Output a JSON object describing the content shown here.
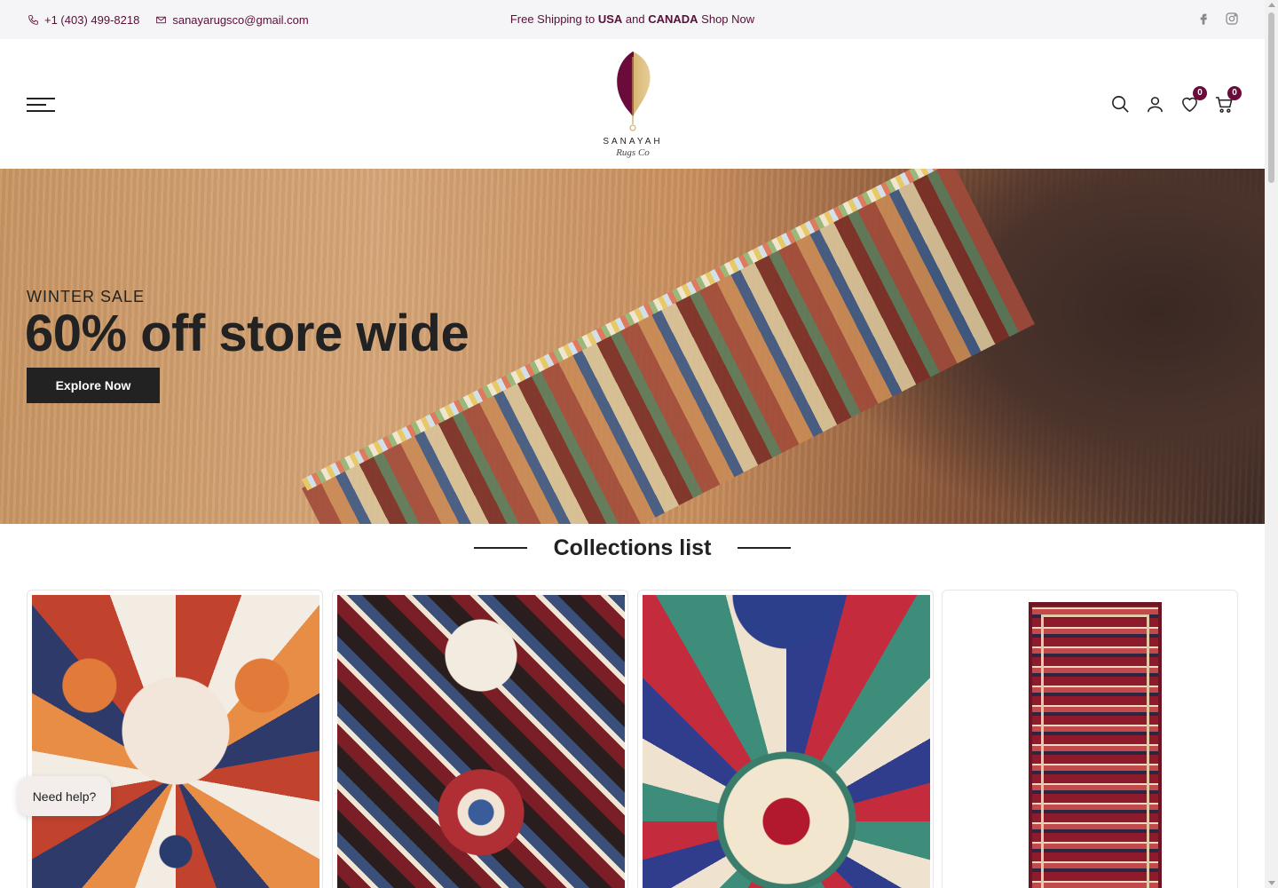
{
  "topbar": {
    "phone": "+1 (403) 499-8218",
    "email": "sanayarugsco@gmail.com",
    "promo_prefix": "Free Shipping to ",
    "promo_usa": "USA",
    "promo_and": " and ",
    "promo_canada": "CANADA",
    "promo_link": " Shop Now",
    "social_icons": [
      "facebook-icon",
      "instagram-icon"
    ]
  },
  "header": {
    "logo_name": "SANAYAH",
    "logo_script": "Rugs Co",
    "wishlist_count": "0",
    "cart_count": "0",
    "icons": [
      "search-icon",
      "account-icon",
      "wishlist-icon",
      "cart-icon"
    ]
  },
  "hero": {
    "subtitle": "WINTER SALE",
    "title": "60% off store wide",
    "button": "Explore Now"
  },
  "collections": {
    "heading": "Collections list",
    "cards": [
      "card-1",
      "card-2",
      "card-3",
      "card-4"
    ]
  },
  "chat": {
    "label": "Need help?"
  },
  "colors": {
    "brand": "#6a0b3c",
    "topbar_bg": "#f5f4f6",
    "button_bg": "#222222"
  }
}
